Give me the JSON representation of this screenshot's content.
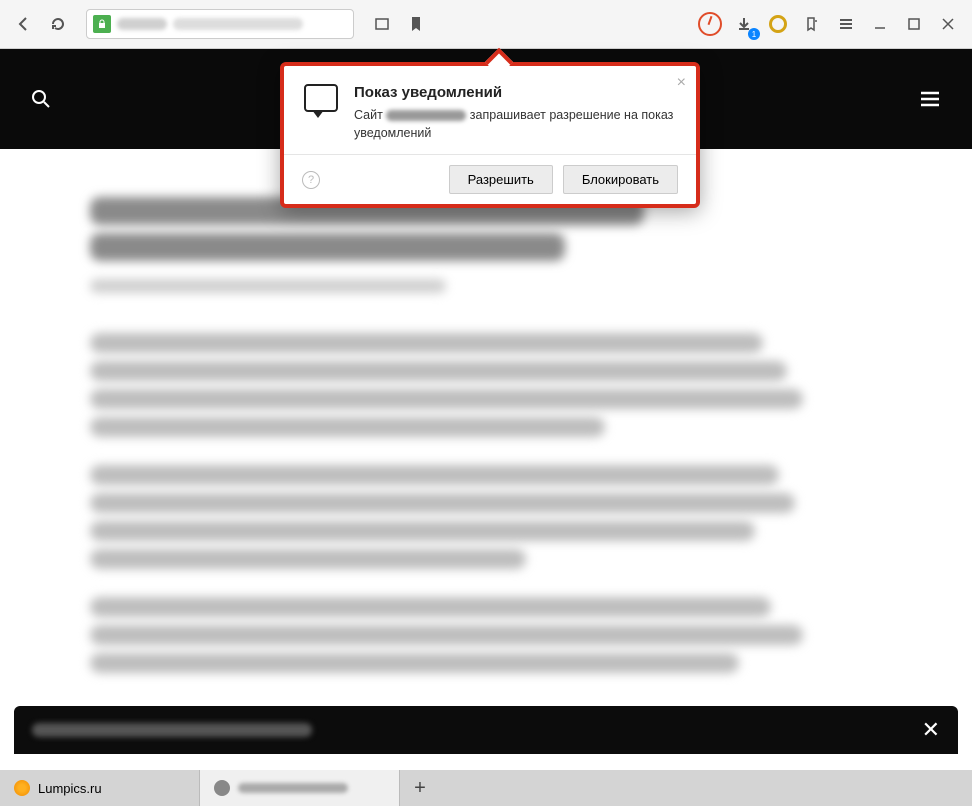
{
  "toolbar": {
    "download_badge": "1"
  },
  "dialog": {
    "title": "Показ уведомлений",
    "text_prefix": "Сайт",
    "text_suffix": "запрашивает разрешение на показ уведомлений",
    "allow_label": "Разрешить",
    "block_label": "Блокировать",
    "help_label": "?",
    "close_label": "×"
  },
  "banner": {
    "close_label": "✕"
  },
  "tabs": {
    "tab1_label": "Lumpics.ru",
    "new_tab_label": "+"
  }
}
